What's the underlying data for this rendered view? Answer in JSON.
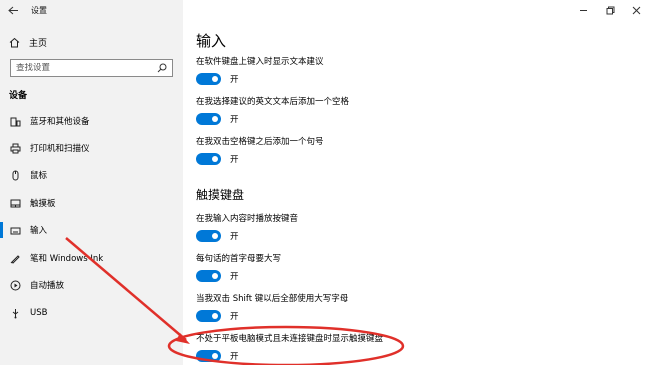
{
  "window": {
    "title": "设置",
    "controls": [
      "minimize",
      "restore",
      "close"
    ]
  },
  "sidebar": {
    "home_label": "主页",
    "search_placeholder": "查找设置",
    "section_label": "设备",
    "items": [
      {
        "label": "蓝牙和其他设备",
        "icon": "bluetooth-devices-icon"
      },
      {
        "label": "打印机和扫描仪",
        "icon": "printer-icon"
      },
      {
        "label": "鼠标",
        "icon": "mouse-icon"
      },
      {
        "label": "触摸板",
        "icon": "touchpad-icon"
      },
      {
        "label": "输入",
        "icon": "keyboard-icon",
        "active": true
      },
      {
        "label": "笔和 Windows Ink",
        "icon": "pen-icon"
      },
      {
        "label": "自动播放",
        "icon": "autoplay-icon"
      },
      {
        "label": "USB",
        "icon": "usb-icon"
      }
    ]
  },
  "main": {
    "heading": "输入",
    "options_top": [
      {
        "label": "在软件键盘上键入时显示文本建议",
        "state": "开",
        "on": true
      },
      {
        "label": "在我选择建议的英文文本后添加一个空格",
        "state": "开",
        "on": true
      },
      {
        "label": "在我双击空格键之后添加一个句号",
        "state": "开",
        "on": true
      }
    ],
    "subheading": "触摸键盘",
    "options_touch": [
      {
        "label": "在我输入内容时播放按键音",
        "state": "开",
        "on": true
      },
      {
        "label": "每句话的首字母要大写",
        "state": "开",
        "on": true
      },
      {
        "label": "当我双击 Shift 键以后全部使用大写字母",
        "state": "开",
        "on": true
      },
      {
        "label": "不处于平板电脑模式且未连接键盘时显示触摸键盘",
        "state": "开",
        "on": true
      }
    ]
  },
  "colors": {
    "accent": "#0078d7",
    "sidebar_bg": "#f2f2f2",
    "annotation": "#e0302a"
  }
}
